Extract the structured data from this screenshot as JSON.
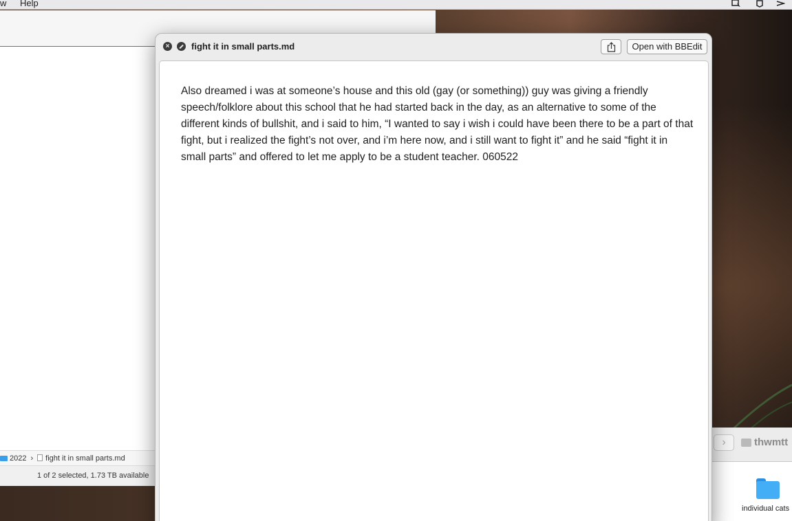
{
  "menubar": {
    "items": [
      "w",
      "Help"
    ]
  },
  "finder": {
    "path": {
      "folder": "2022",
      "separator": "›",
      "file": "fight it in small parts.md"
    },
    "status": "1 of 2 selected, 1.73 TB available"
  },
  "finder2": {
    "forward": "›",
    "crumb": "thwmtt",
    "folder_label": "individual cats"
  },
  "quicklook": {
    "title": "fight it in small parts.md",
    "open_with_label": "Open with BBEdit",
    "close_symbol": "×",
    "content": "Also dreamed i was at someone’s house and this old (gay (or something)) guy was giving a friendly speech/folklore about this school that he had started back in the day, as an alternative to some of the different kinds of bullshit, and i said to him, “I wanted to say i wish i could have been there to be a part of that fight, but i realized the fight’s not over, and i’m here now, and i still want to fight it” and he said “fight it in small parts” and offered to let me apply to be a student teacher. 060522"
  },
  "icons": [
    "screen-capture-icon",
    "notification-icon",
    "navigation-icon",
    "share-icon",
    "close-icon",
    "fullscreen-icon",
    "folder-icon",
    "document-icon"
  ]
}
